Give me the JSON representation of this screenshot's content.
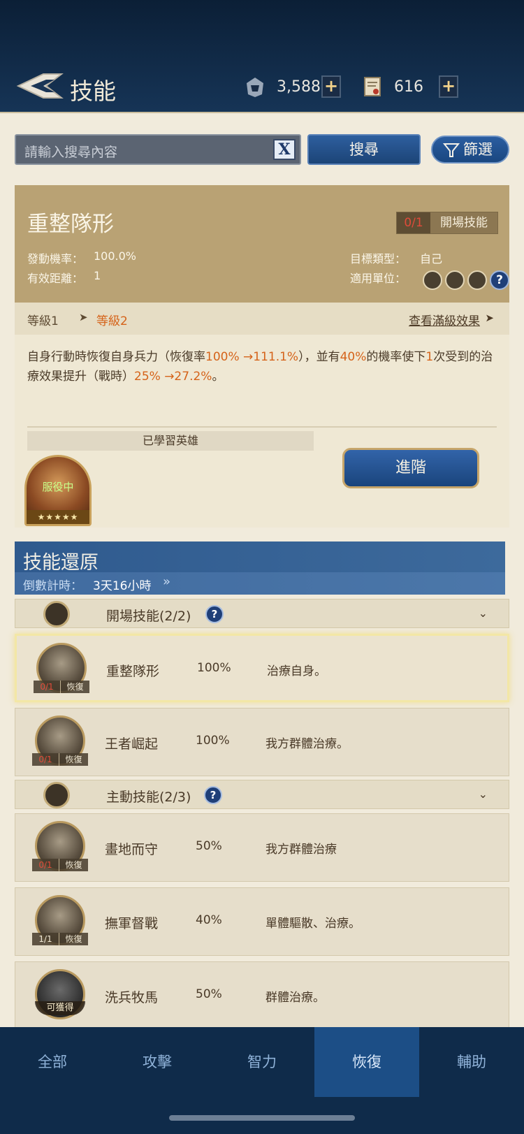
{
  "header": {
    "title": "技能",
    "resources": [
      {
        "icon": "helmet-icon",
        "value": "3,588"
      },
      {
        "icon": "scroll-icon",
        "value": "616"
      }
    ]
  },
  "search": {
    "placeholder": "請輸入搜尋內容",
    "clear_label": "X",
    "button_label": "搜尋",
    "filter_label": "篩選"
  },
  "skill": {
    "name": "重整隊形",
    "count": "0/1",
    "type": "開場技能",
    "activation_label": "發動機率：",
    "activation_value": "100.0%",
    "range_label": "有效距離：",
    "range_value": "1",
    "target_label": "目標類型：",
    "target_value": "自己",
    "units_label": "適用單位：",
    "level_from": "等級1",
    "level_to": "等級2",
    "max_level_link": "查看滿級效果",
    "desc": {
      "p1": "自身行動時恢復自身兵力（恢復率",
      "h1": "100% →111.1%",
      "p2": "），並有",
      "h2": "40%",
      "p3": "的機率使下",
      "h3": "1",
      "p4": "次受到的治療效果提升（戰時）",
      "h4": "25% →27.2%",
      "p5": "。"
    },
    "learned_label": "已學習英雄",
    "hero_status": "服役中",
    "hero_stars": "★★★★★",
    "advance_label": "進階"
  },
  "restore": {
    "title": "技能還原",
    "countdown_label": "倒數計時：",
    "countdown_value": "3天16小時",
    "countdown_arrow": "»"
  },
  "groups": [
    {
      "title": "開場技能(2/2)",
      "help": "?",
      "chevron": "⌄"
    },
    {
      "title": "主動技能(2/3)",
      "help": "?",
      "chevron": "⌄"
    }
  ],
  "rows": [
    {
      "name": "重整隊形",
      "rate": "100%",
      "desc": "治療自身。",
      "count": "0/1",
      "type": "恢復"
    },
    {
      "name": "王者崛起",
      "rate": "100%",
      "desc": "我方群體治療。",
      "count": "0/1",
      "type": "恢復"
    },
    {
      "name": "畫地而守",
      "rate": "50%",
      "desc": "我方群體治療",
      "count": "0/1",
      "type": "恢復"
    },
    {
      "name": "撫軍督戰",
      "rate": "40%",
      "desc": "單體驅散、治療。",
      "count": "1/1",
      "type": "恢復"
    },
    {
      "name": "洗兵牧馬",
      "rate": "50%",
      "desc": "群體治療。",
      "obtain": "可獲得"
    }
  ],
  "tabs": [
    "全部",
    "攻擊",
    "智力",
    "恢復",
    "輔助"
  ],
  "active_tab": "恢復",
  "colors": {
    "highlight": "#d5631a",
    "accent_blue": "#1c4e86",
    "parchment": "#f1ebdc",
    "header_gold": "#b9a274"
  }
}
